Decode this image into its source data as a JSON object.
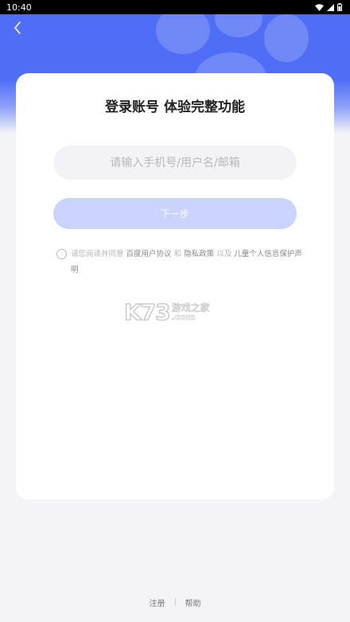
{
  "status_bar": {
    "time": "10:40",
    "icons": [
      "wifi-icon",
      "signal-icon",
      "battery-icon"
    ]
  },
  "header": {
    "back_icon": "chevron-left-icon"
  },
  "login": {
    "title": "登录账号 体验完整功能",
    "account_placeholder": "请输入手机号/用户名/邮箱",
    "account_value": "",
    "next_label": "下一步",
    "agreement": {
      "prefix": "请您阅读并同意",
      "link_user_agreement": "百度用户协议",
      "and": "和",
      "link_privacy": "隐私政策",
      "also": "以及",
      "link_child_privacy": "儿童个人信息保护声明"
    }
  },
  "watermark": {
    "logo": "K73",
    "name": "游戏之家",
    "domain": ".com"
  },
  "footer": {
    "register": "注册",
    "help": "帮助"
  },
  "colors": {
    "brand_blue": "#4f6ef5",
    "button_disabled": "#c9d3fb",
    "background": "#f4f4f6"
  }
}
